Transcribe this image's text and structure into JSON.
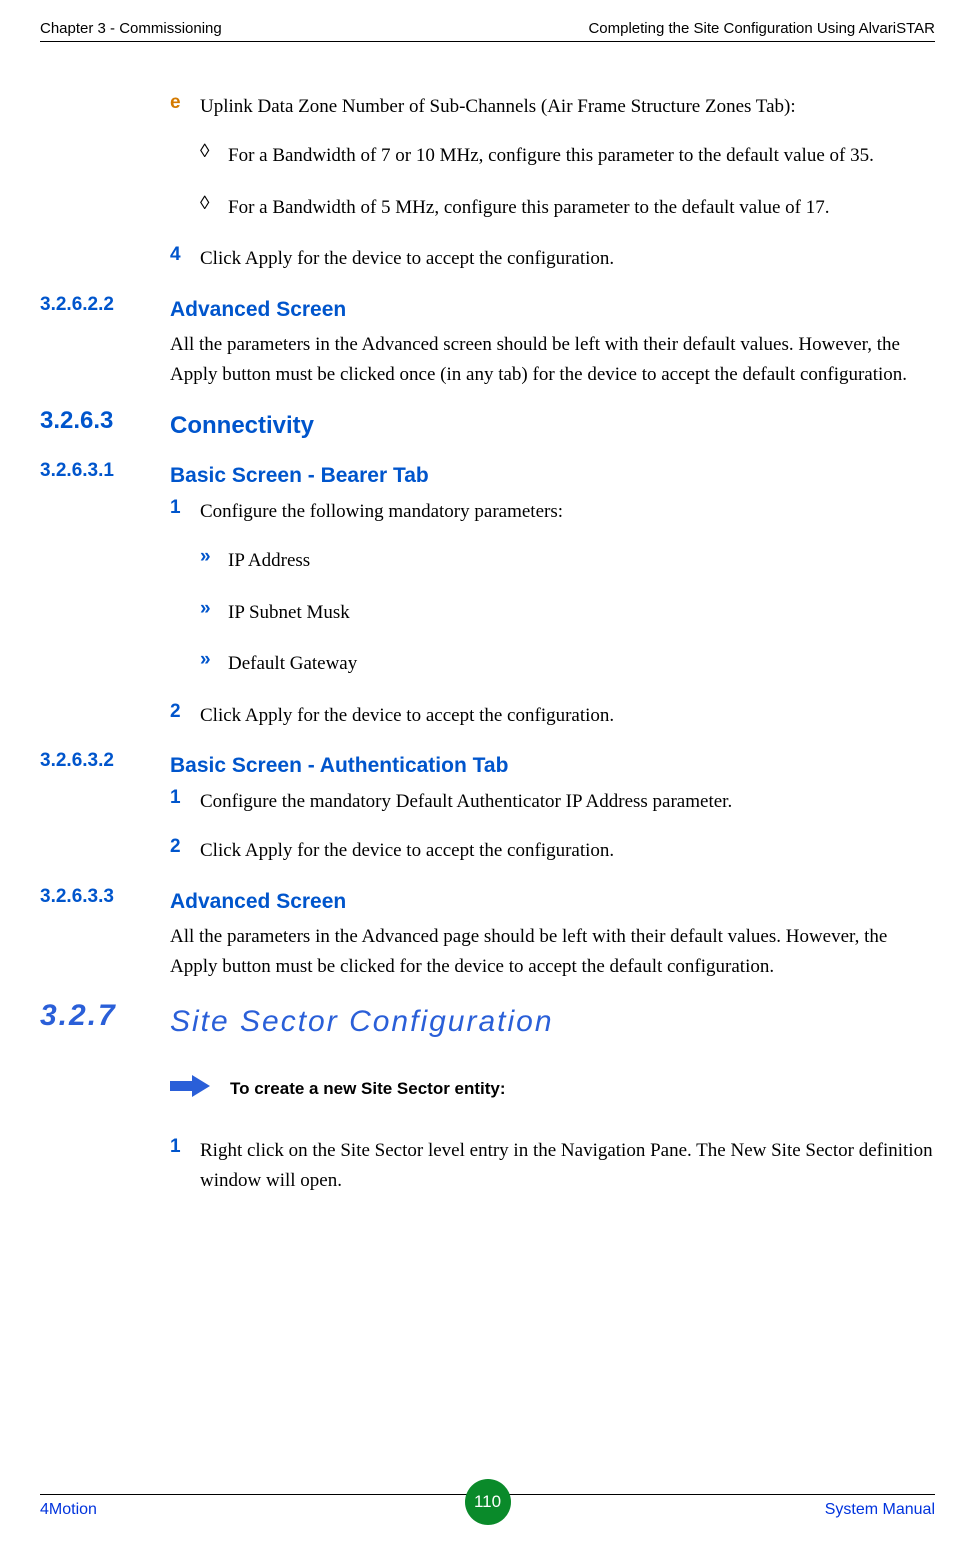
{
  "header": {
    "left": "Chapter 3 - Commissioning",
    "right": "Completing the Site Configuration Using AlvariSTAR"
  },
  "items": {
    "e_label": "e",
    "e_text": "Uplink Data Zone Number of Sub-Channels (Air Frame Structure Zones Tab):",
    "e_d1": "For a Bandwidth of 7 or 10 MHz, configure this parameter to the default value of 35.",
    "e_d2": "For a Bandwidth of 5 MHz, configure this parameter to the default value of 17.",
    "step4_label": "4",
    "step4_text": "Click Apply for the device to accept the configuration."
  },
  "sec_32622": {
    "num": "3.2.6.2.2",
    "title": "Advanced Screen",
    "para": "All the parameters in the Advanced screen should be left with their default values. However, the Apply button must be clicked once (in any tab) for the device to accept the default configuration."
  },
  "sec_3263": {
    "num": "3.2.6.3",
    "title": "Connectivity"
  },
  "sec_32631": {
    "num": "3.2.6.3.1",
    "title": "Basic Screen - Bearer Tab",
    "s1_label": "1",
    "s1_text": "Configure the following mandatory parameters:",
    "b1": "IP Address",
    "b2": "IP Subnet Musk",
    "b3": "Default Gateway",
    "s2_label": "2",
    "s2_text": "Click Apply for the device to accept the configuration."
  },
  "sec_32632": {
    "num": "3.2.6.3.2",
    "title": "Basic Screen - Authentication Tab",
    "s1_label": "1",
    "s1_text": "Configure the mandatory Default Authenticator IP Address parameter.",
    "s2_label": "2",
    "s2_text": "Click Apply for the device to accept the configuration."
  },
  "sec_32633": {
    "num": "3.2.6.3.3",
    "title": "Advanced Screen",
    "para": "All the parameters in the Advanced page should be left with their default values. However, the Apply button must be clicked for the device to accept the default configuration."
  },
  "sec_327": {
    "num": "3.2.7",
    "title": "Site Sector Configuration",
    "callout": "To create a new Site Sector entity:",
    "s1_label": "1",
    "s1_text": "Right click on the Site Sector level entry in the Navigation Pane. The New Site Sector definition window will open."
  },
  "footer": {
    "left": "4Motion",
    "center": "110",
    "right": "System Manual"
  },
  "glyphs": {
    "diamond": "◊",
    "arrows": "»"
  }
}
